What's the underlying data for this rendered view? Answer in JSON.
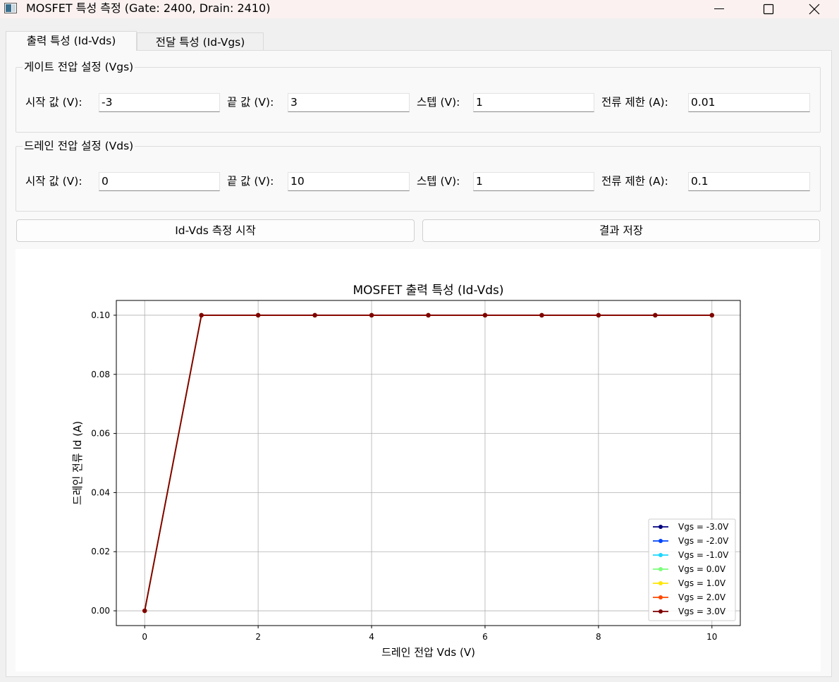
{
  "window": {
    "title": "MOSFET 특성 측정 (Gate: 2400, Drain: 2410)"
  },
  "tabs": [
    {
      "label": "출력 특성 (Id-Vds)",
      "active": true
    },
    {
      "label": "전달 특성 (Id-Vgs)",
      "active": false
    }
  ],
  "gate_group": {
    "title": "게이트 전압 설정 (Vgs)",
    "start_label": "시작 값 (V):",
    "start_value": "-3",
    "end_label": "끝 값 (V):",
    "end_value": "3",
    "step_label": "스텝 (V):",
    "step_value": "1",
    "limit_label": "전류 제한 (A):",
    "limit_value": "0.01"
  },
  "drain_group": {
    "title": "드레인 전압 설정 (Vds)",
    "start_label": "시작 값 (V):",
    "start_value": "0",
    "end_label": "끝 값 (V):",
    "end_value": "10",
    "step_label": "스텝 (V):",
    "step_value": "1",
    "limit_label": "전류 제한 (A):",
    "limit_value": "0.1"
  },
  "buttons": {
    "measure": "Id-Vds 측정 시작",
    "save": "결과 저장"
  },
  "chart_data": {
    "type": "line",
    "title": "MOSFET 출력 특성 (Id-Vds)",
    "xlabel": "드레인 전압 Vds (V)",
    "ylabel": "드레인 전류 Id (A)",
    "xlim": [
      -0.5,
      10.5
    ],
    "ylim": [
      -0.005,
      0.105
    ],
    "xticks": [
      0,
      2,
      4,
      6,
      8,
      10
    ],
    "yticks": [
      0.0,
      0.02,
      0.04,
      0.06,
      0.08,
      0.1
    ],
    "ytick_labels": [
      "0.00",
      "0.02",
      "0.04",
      "0.06",
      "0.08",
      "0.10"
    ],
    "grid": true,
    "legend_position": "lower-right",
    "x": [
      0,
      1,
      2,
      3,
      4,
      5,
      6,
      7,
      8,
      9,
      10
    ],
    "series": [
      {
        "name": "Vgs = -3.0V",
        "color": "#00007f",
        "values": [
          0.0,
          0.1,
          0.1,
          0.1,
          0.1,
          0.1,
          0.1,
          0.1,
          0.1,
          0.1,
          0.1
        ]
      },
      {
        "name": "Vgs = -2.0V",
        "color": "#0044ff",
        "values": [
          0.0,
          0.1,
          0.1,
          0.1,
          0.1,
          0.1,
          0.1,
          0.1,
          0.1,
          0.1,
          0.1
        ]
      },
      {
        "name": "Vgs = -1.0V",
        "color": "#1ad6ff",
        "values": [
          0.0,
          0.1,
          0.1,
          0.1,
          0.1,
          0.1,
          0.1,
          0.1,
          0.1,
          0.1,
          0.1
        ]
      },
      {
        "name": "Vgs = 0.0V",
        "color": "#7cff7a",
        "values": [
          0.0,
          0.1,
          0.1,
          0.1,
          0.1,
          0.1,
          0.1,
          0.1,
          0.1,
          0.1,
          0.1
        ]
      },
      {
        "name": "Vgs = 1.0V",
        "color": "#ffe600",
        "values": [
          0.0,
          0.1,
          0.1,
          0.1,
          0.1,
          0.1,
          0.1,
          0.1,
          0.1,
          0.1,
          0.1
        ]
      },
      {
        "name": "Vgs = 2.0V",
        "color": "#ff4800",
        "values": [
          0.0,
          0.1,
          0.1,
          0.1,
          0.1,
          0.1,
          0.1,
          0.1,
          0.1,
          0.1,
          0.1
        ]
      },
      {
        "name": "Vgs = 3.0V",
        "color": "#7f0000",
        "values": [
          0.0,
          0.1,
          0.1,
          0.1,
          0.1,
          0.1,
          0.1,
          0.1,
          0.1,
          0.1,
          0.1
        ]
      }
    ]
  }
}
